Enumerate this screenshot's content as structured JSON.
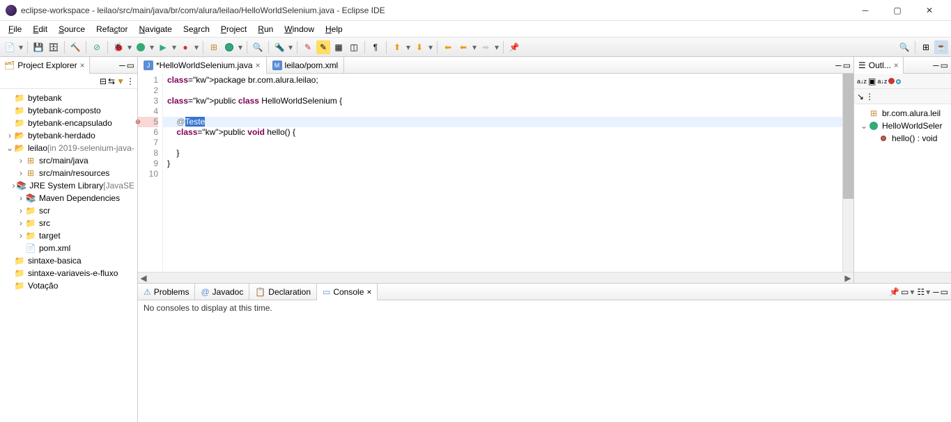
{
  "window": {
    "title": "eclipse-workspace - leilao/src/main/java/br/com/alura/leilao/HelloWorldSelenium.java - Eclipse IDE"
  },
  "menubar": [
    {
      "label": "File",
      "u": 0
    },
    {
      "label": "Edit",
      "u": 0
    },
    {
      "label": "Source",
      "u": 0
    },
    {
      "label": "Refactor",
      "u": 4
    },
    {
      "label": "Navigate",
      "u": 0
    },
    {
      "label": "Search",
      "u": 2
    },
    {
      "label": "Project",
      "u": 0
    },
    {
      "label": "Run",
      "u": 0
    },
    {
      "label": "Window",
      "u": 0
    },
    {
      "label": "Help",
      "u": 0
    }
  ],
  "project_explorer": {
    "title": "Project Explorer",
    "items": [
      {
        "depth": 0,
        "icon": "folder",
        "label": "bytebank"
      },
      {
        "depth": 0,
        "icon": "folder",
        "label": "bytebank-composto"
      },
      {
        "depth": 0,
        "icon": "folder",
        "label": "bytebank-encapsulado"
      },
      {
        "depth": 0,
        "icon": "folder-open",
        "label": "bytebank-herdado",
        "arrow": ">"
      },
      {
        "depth": 0,
        "icon": "folder-open",
        "label": "leilao",
        "suffix": " [in 2019-selenium-java-",
        "arrow": "v"
      },
      {
        "depth": 1,
        "icon": "pkg",
        "label": "src/main/java",
        "arrow": ">"
      },
      {
        "depth": 1,
        "icon": "pkg",
        "label": "src/main/resources",
        "arrow": ">"
      },
      {
        "depth": 1,
        "icon": "jar",
        "label": "JRE System Library",
        "suffix": " [JavaSE",
        "arrow": ">"
      },
      {
        "depth": 1,
        "icon": "jar",
        "label": "Maven Dependencies",
        "arrow": ">"
      },
      {
        "depth": 1,
        "icon": "folder-y",
        "label": "scr",
        "arrow": ">"
      },
      {
        "depth": 1,
        "icon": "folder-y",
        "label": "src",
        "arrow": ">"
      },
      {
        "depth": 1,
        "icon": "folder-y",
        "label": "target",
        "arrow": ">"
      },
      {
        "depth": 1,
        "icon": "file",
        "label": "pom.xml"
      },
      {
        "depth": 0,
        "icon": "folder",
        "label": "sintaxe-basica"
      },
      {
        "depth": 0,
        "icon": "folder",
        "label": "sintaxe-variaveis-e-fluxo"
      },
      {
        "depth": 0,
        "icon": "folder",
        "label": "Votação"
      }
    ]
  },
  "editor_tabs": [
    {
      "icon": "j",
      "label": "*HelloWorldSelenium.java",
      "active": true
    },
    {
      "icon": "m",
      "label": "leilao/pom.xml",
      "active": false
    }
  ],
  "code": {
    "lines": [
      {
        "n": 1,
        "raw": "package br.com.alura.leilao;"
      },
      {
        "n": 2,
        "raw": ""
      },
      {
        "n": 3,
        "raw": "public class HelloWorldSelenium {"
      },
      {
        "n": 4,
        "raw": ""
      },
      {
        "n": 5,
        "raw": "    @Teste",
        "highlight": true,
        "error": true,
        "sel_start": 5,
        "sel_end": 10
      },
      {
        "n": 6,
        "raw": "    public void hello() {"
      },
      {
        "n": 7,
        "raw": ""
      },
      {
        "n": 8,
        "raw": "    }"
      },
      {
        "n": 9,
        "raw": "}"
      },
      {
        "n": 10,
        "raw": ""
      }
    ]
  },
  "outline": {
    "title": "Outl...",
    "items": [
      {
        "depth": 0,
        "icon": "pkg",
        "label": "br.com.alura.leil"
      },
      {
        "depth": 0,
        "icon": "class",
        "label": "HelloWorldSeler",
        "arrow": "v"
      },
      {
        "depth": 1,
        "icon": "method-err",
        "label": "hello() : void"
      }
    ]
  },
  "bottom_tabs": [
    {
      "icon": "prob",
      "label": "Problems"
    },
    {
      "icon": "at",
      "label": "Javadoc"
    },
    {
      "icon": "decl",
      "label": "Declaration"
    },
    {
      "icon": "cons",
      "label": "Console",
      "active": true
    }
  ],
  "console_message": "No consoles to display at this time."
}
